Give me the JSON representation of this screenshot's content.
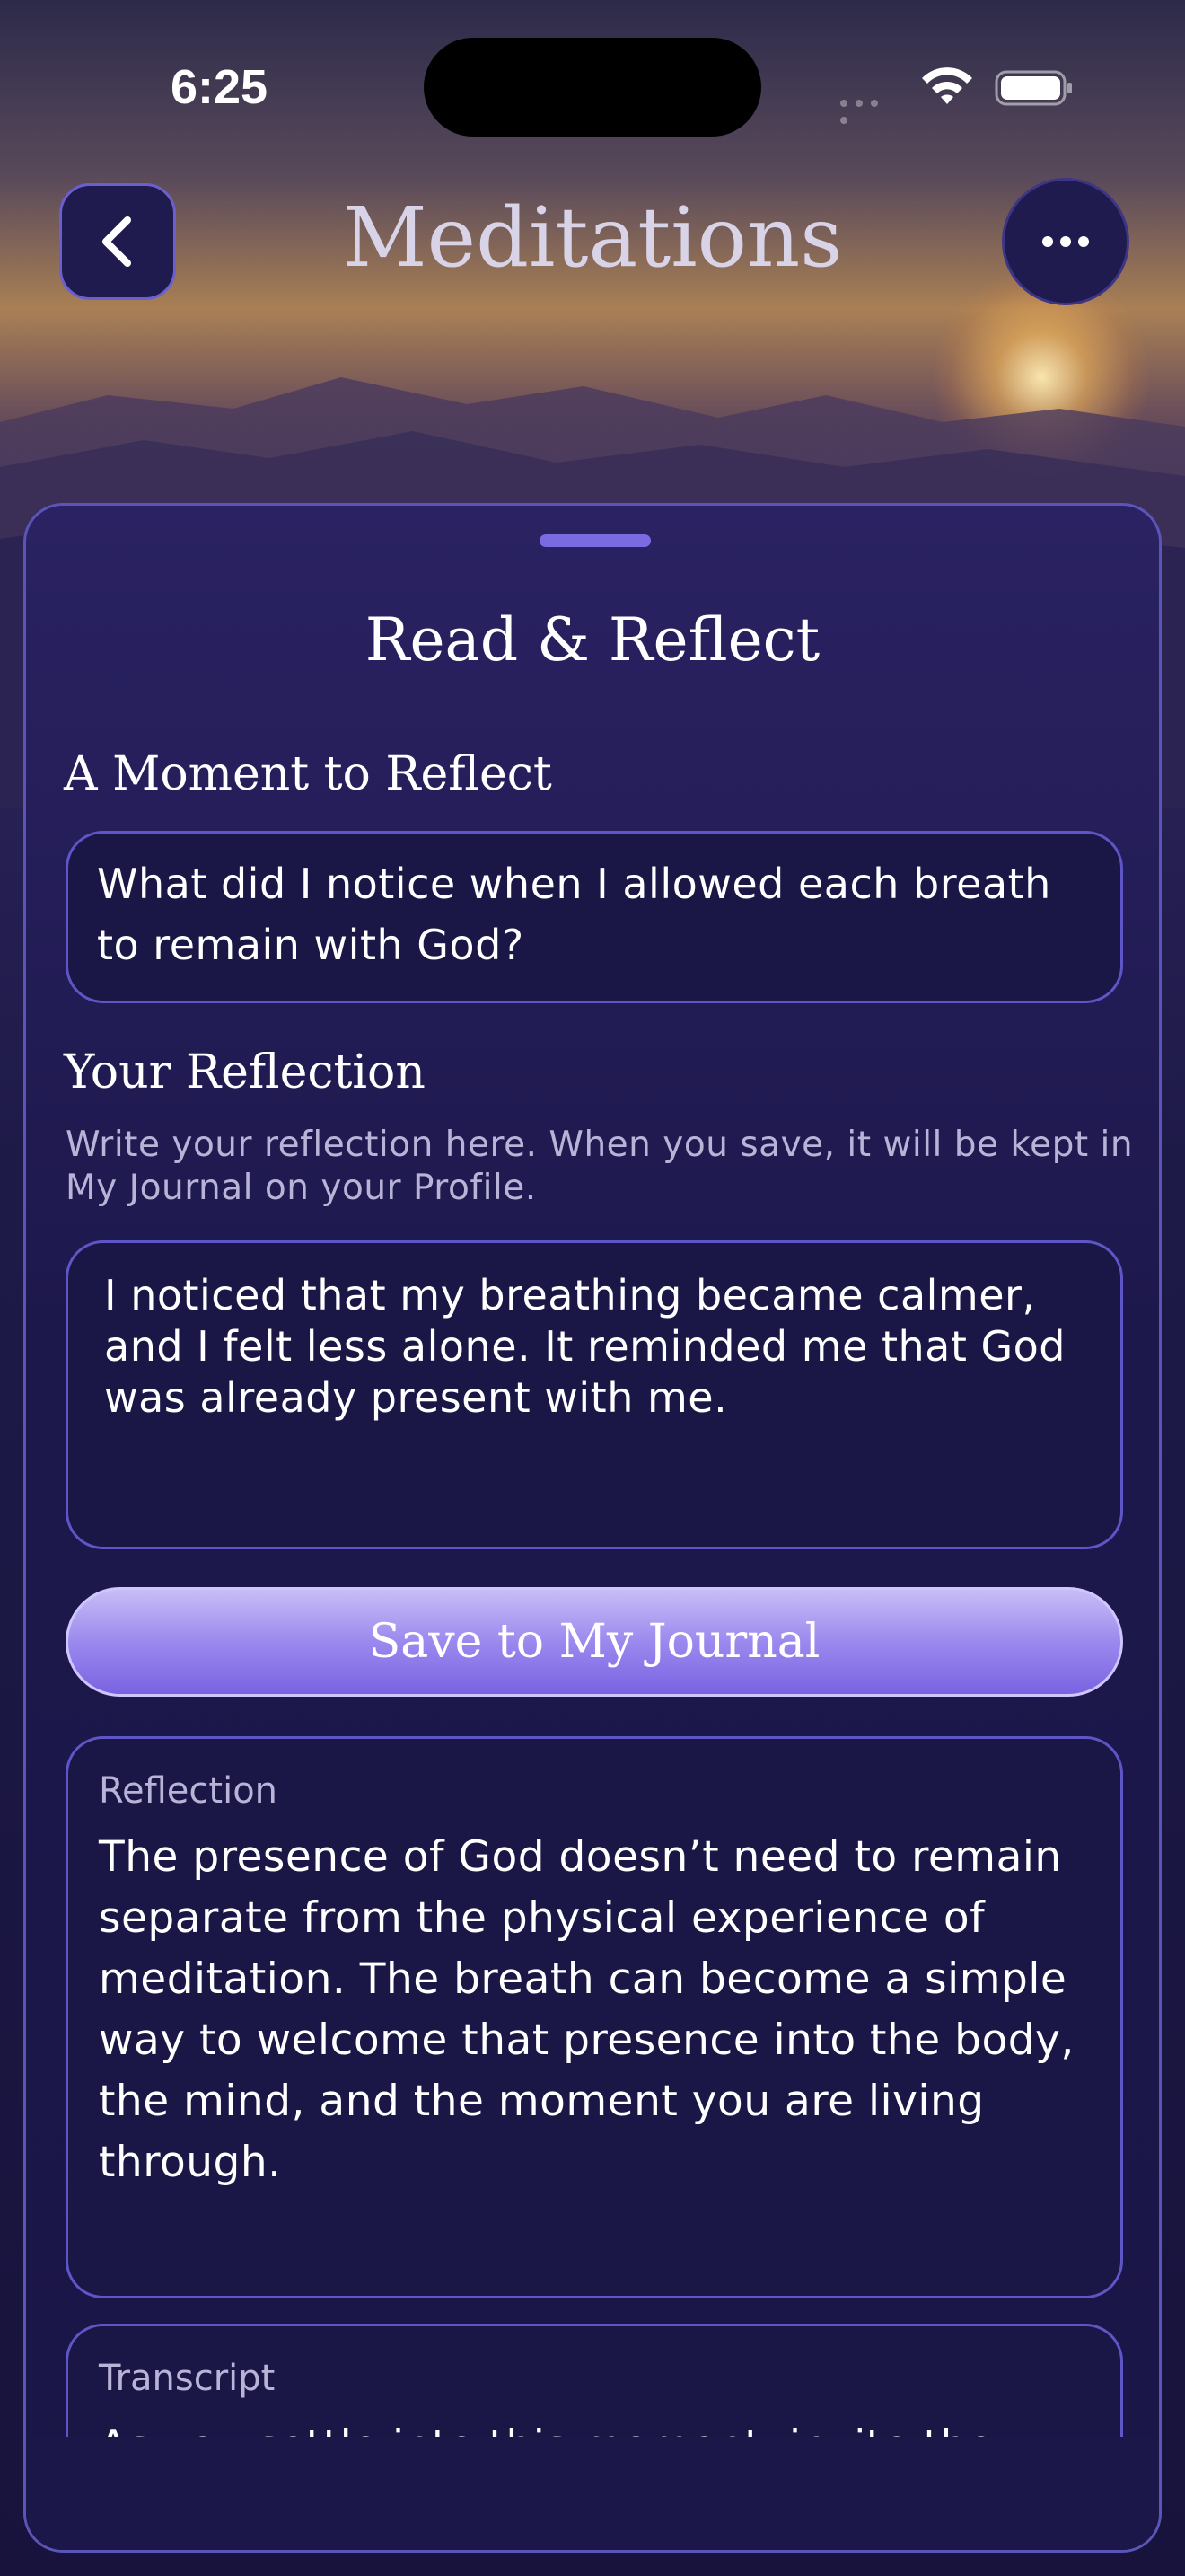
{
  "status_bar": {
    "time": "6:25"
  },
  "header": {
    "title": "Meditations"
  },
  "sheet": {
    "title": "Read & Reflect",
    "moment": {
      "heading": "A Moment to Reflect",
      "prompt": "What did I notice when I allowed each breath to remain with God?"
    },
    "your_reflection": {
      "heading": "Your Reflection",
      "hint": "Write your reflection here. When you save, it will be kept in My Journal on your Profile.",
      "value": "I noticed that my breathing became calmer, and I felt less alone. It reminded me that God was already present with me."
    },
    "save_button": "Save to My Journal",
    "reflection_card": {
      "label": "Reflection",
      "body": "The presence of God doesn’t need to remain separate from the physical experience of meditation. The breath can become a simple way to welcome that presence into the body, the mind, and the moment you are living through."
    },
    "transcript_card": {
      "label": "Transcript",
      "body": "As you settle into this moment, invite the"
    }
  },
  "icons": {
    "back": "chevron-left-icon",
    "more": "ellipsis-icon",
    "wifi": "wifi-icon",
    "battery": "battery-icon",
    "signal": "cellular-signal-icon"
  },
  "colors": {
    "accent": "#7a63e2",
    "sheet_background": "#1d184c",
    "border": "#5e55c6"
  }
}
